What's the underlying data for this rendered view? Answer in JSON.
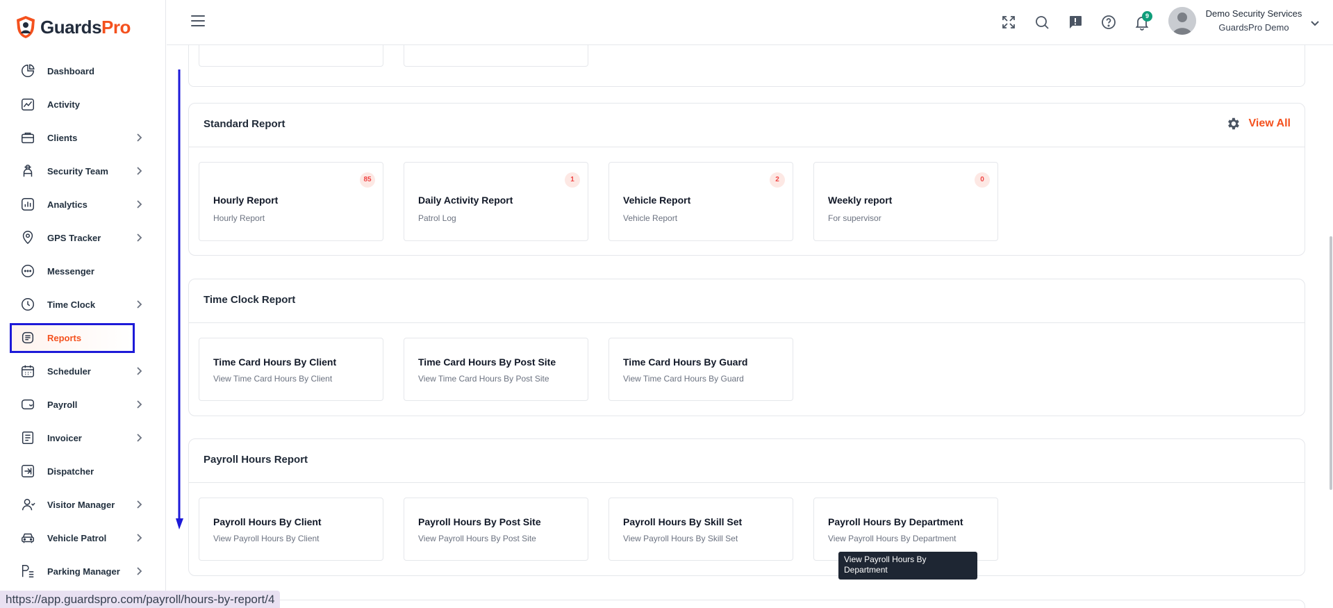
{
  "brand": {
    "word1": "Guards",
    "word2": "Pro"
  },
  "sidebar": {
    "items": [
      {
        "label": "Dashboard",
        "icon": "pie-chart-icon",
        "has_chevron": false
      },
      {
        "label": "Activity",
        "icon": "activity-icon",
        "has_chevron": false
      },
      {
        "label": "Clients",
        "icon": "briefcase-icon",
        "has_chevron": true
      },
      {
        "label": "Security Team",
        "icon": "guard-icon",
        "has_chevron": true
      },
      {
        "label": "Analytics",
        "icon": "bar-chart-icon",
        "has_chevron": true
      },
      {
        "label": "GPS Tracker",
        "icon": "map-pin-icon",
        "has_chevron": true
      },
      {
        "label": "Messenger",
        "icon": "chat-icon",
        "has_chevron": false
      },
      {
        "label": "Time Clock",
        "icon": "clock-icon",
        "has_chevron": true
      },
      {
        "label": "Reports",
        "icon": "report-icon",
        "has_chevron": false,
        "active": true
      },
      {
        "label": "Scheduler",
        "icon": "calendar-icon",
        "has_chevron": true
      },
      {
        "label": "Payroll",
        "icon": "wallet-icon",
        "has_chevron": true
      },
      {
        "label": "Invoicer",
        "icon": "invoice-icon",
        "has_chevron": true
      },
      {
        "label": "Dispatcher",
        "icon": "dispatch-icon",
        "has_chevron": false
      },
      {
        "label": "Visitor Manager",
        "icon": "visitor-icon",
        "has_chevron": true
      },
      {
        "label": "Vehicle Patrol",
        "icon": "car-icon",
        "has_chevron": true
      },
      {
        "label": "Parking Manager",
        "icon": "parking-icon",
        "has_chevron": true
      }
    ]
  },
  "header": {
    "notification_count": "9",
    "user_name": "Demo Security Services",
    "user_org": "GuardsPro Demo"
  },
  "standard_report": {
    "title": "Standard Report",
    "view_all": "View All",
    "cards": [
      {
        "title": "Hourly Report",
        "subtitle": "Hourly Report",
        "count": "85"
      },
      {
        "title": "Daily Activity Report",
        "subtitle": "Patrol Log",
        "count": "1"
      },
      {
        "title": "Vehicle Report",
        "subtitle": "Vehicle Report",
        "count": "2"
      },
      {
        "title": "Weekly report",
        "subtitle": "For supervisor",
        "count": "0"
      }
    ]
  },
  "time_clock_report": {
    "title": "Time Clock Report",
    "cards": [
      {
        "title": "Time Card Hours By Client",
        "subtitle": "View Time Card Hours By Client"
      },
      {
        "title": "Time Card Hours By Post Site",
        "subtitle": "View Time Card Hours By Post Site"
      },
      {
        "title": "Time Card Hours By Guard",
        "subtitle": "View Time Card Hours By Guard"
      }
    ]
  },
  "payroll_hours_report": {
    "title": "Payroll Hours Report",
    "cards": [
      {
        "title": "Payroll Hours By Client",
        "subtitle": "View Payroll Hours By Client"
      },
      {
        "title": "Payroll Hours By Post Site",
        "subtitle": "View Payroll Hours By Post Site"
      },
      {
        "title": "Payroll Hours By Skill Set",
        "subtitle": "View Payroll Hours By Skill Set"
      },
      {
        "title": "Payroll Hours By Department",
        "subtitle": "View Payroll Hours By Department"
      }
    ]
  },
  "tooltip": "View Payroll Hours By Department",
  "status_url": "https://app.guardspro.com/payroll/hours-by-report/4",
  "colors": {
    "accent": "#f4511e",
    "annotation": "#1d1ad8",
    "badge_bg": "#fde8e4",
    "badge_text": "#ef4444"
  }
}
